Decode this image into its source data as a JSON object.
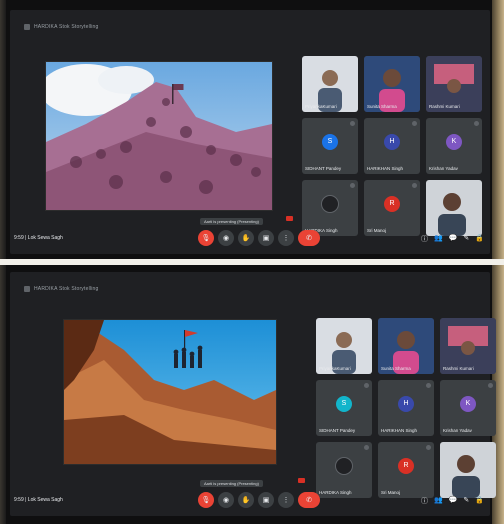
{
  "frames": [
    {
      "id": "top",
      "window_title": "HARDIKA Stok Storytelling",
      "meeting_time": "9:59  |  Lok Sewa Sagh",
      "present_tip": "Aarti is presenting (Presenting)",
      "participants": [
        {
          "name": "PriyankaKumari"
        },
        {
          "name": "Sunita Sharma"
        },
        {
          "name": "Rashmi Kumari"
        },
        {
          "name": "SIDHANT Pandey"
        },
        {
          "name": "HARIKHAN Singh"
        },
        {
          "name": "Krishan Yadav"
        },
        {
          "name": "HARDIKA Singh"
        },
        {
          "name": "Sri Manoj"
        },
        {
          "name": ""
        }
      ],
      "tile_initials": [
        "",
        "",
        "",
        "S",
        "H",
        "K",
        "",
        "R",
        ""
      ]
    },
    {
      "id": "bottom",
      "window_title": "HARDIKA Stok Storytelling",
      "meeting_time": "9:59  |  Lok Sewa Sagh",
      "present_tip": "Aarti is presenting (Presenting)",
      "participants": [
        {
          "name": "PriyankaKumari"
        },
        {
          "name": "Sunita Sharma"
        },
        {
          "name": "Rashmi Kumari"
        },
        {
          "name": "SIDHANT Pandey"
        },
        {
          "name": "HARIKHAN Singh"
        },
        {
          "name": "Krishan Yadav"
        },
        {
          "name": "HARDIKA Singh"
        },
        {
          "name": "Sri Manoj"
        },
        {
          "name": ""
        }
      ],
      "tile_initials": [
        "",
        "",
        "",
        "S",
        "H",
        "K",
        "",
        "R",
        ""
      ]
    }
  ],
  "controls": {
    "icons": [
      "mic-off-icon",
      "camera-icon",
      "raise-hand-icon",
      "present-icon",
      "more-icon",
      "end-call-icon"
    ],
    "glyphs": [
      "🎙",
      "◉",
      "✋",
      "▣",
      "⋮",
      "✆"
    ]
  },
  "right_tools": {
    "icons": [
      "info-icon",
      "people-icon",
      "chat-icon",
      "activities-icon",
      "lock-icon"
    ],
    "glyphs": [
      "ⓘ",
      "👥",
      "💬",
      "✎",
      "🔒"
    ]
  },
  "colors": {
    "meet_dark": "#202124",
    "tile_gray": "#3c4043",
    "end_call_red": "#ea4335",
    "avatar_blue": "#1a73e8",
    "avatar_teal": "#12b5cb",
    "avatar_purple": "#7e57c2"
  }
}
